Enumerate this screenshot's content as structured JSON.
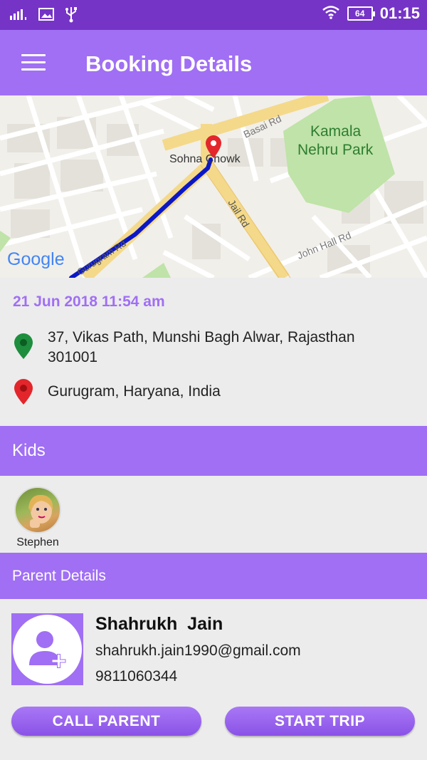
{
  "status_bar": {
    "time": "01:15",
    "battery": "64"
  },
  "app_bar": {
    "title": "Booking Details"
  },
  "map": {
    "labels": {
      "basai": "Basai Rd",
      "sohna": "Sohna Chowk",
      "kamala1": "Kamala",
      "kamala2": "Nehru Park",
      "jail": "Jail Rd",
      "johnhall": "John Hall Rd",
      "gurugram": "Gurugram Rd",
      "google": "Google"
    }
  },
  "trip": {
    "datetime": "21 Jun 2018 11:54 am",
    "pickup": "37, Vikas Path, Munshi Bagh Alwar, Rajasthan 301001",
    "drop": "Gurugram, Haryana, India"
  },
  "kids": {
    "heading": "Kids",
    "items": [
      {
        "name": "Stephen"
      }
    ]
  },
  "parent": {
    "heading": "Parent Details",
    "name": "Shahrukh  Jain",
    "email": "shahrukh.jain1990@gmail.com",
    "phone": "9811060344"
  },
  "actions": {
    "call": "CALL PARENT",
    "start": "START TRIP"
  },
  "colors": {
    "status_bar": "#7534c6",
    "accent": "#a06ff4",
    "pickup_pin": "#1e8e3e",
    "drop_pin": "#e3262b",
    "route": "#0a17c8"
  }
}
